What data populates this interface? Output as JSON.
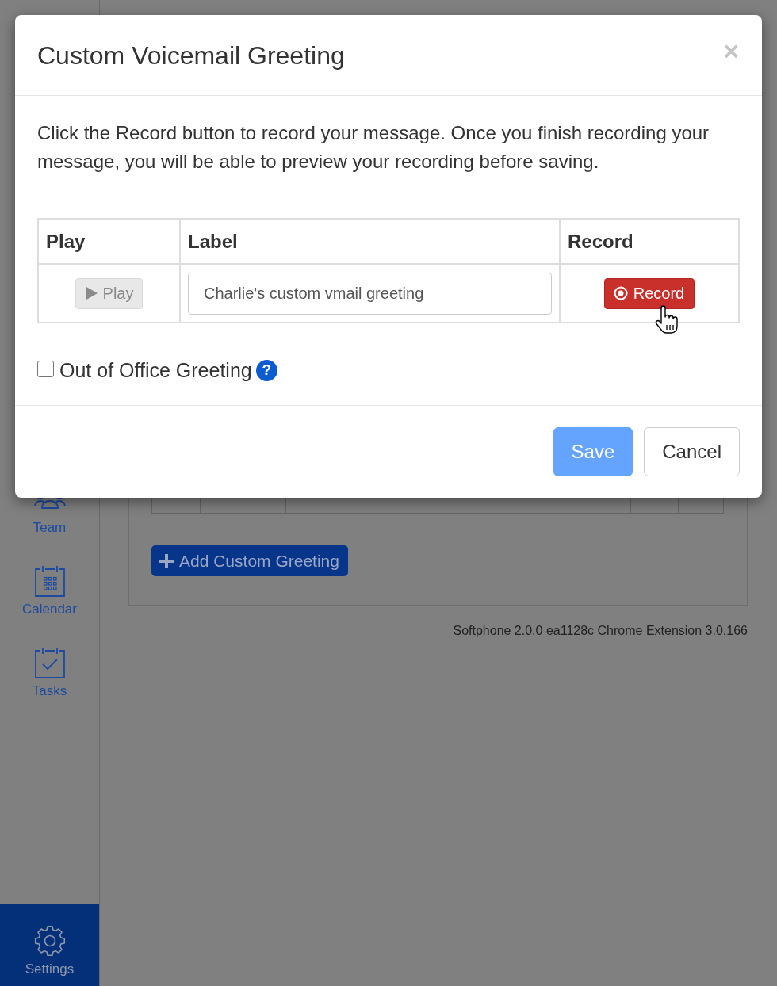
{
  "sidebar": {
    "items": [
      {
        "kind": "team",
        "label": "Team",
        "selected": false
      },
      {
        "kind": "calendar",
        "label": "Calendar",
        "selected": false
      },
      {
        "kind": "tasks",
        "label": "Tasks",
        "selected": false
      },
      {
        "kind": "settings",
        "label": "Settings",
        "selected": true
      }
    ]
  },
  "main": {
    "add_button": {
      "label": "Add Custom Greeting"
    },
    "version": "Softphone 2.0.0 ea1128c Chrome Extension 3.0.166"
  },
  "dialog": {
    "title": "Custom Voicemail Greeting",
    "close": "×",
    "message": "Click the Record button to record your message. Once you finish recording your message, you will be able to preview your recording before saving.",
    "table": {
      "columns": [
        "Play",
        "Label",
        "Record"
      ],
      "rows": [
        {
          "play_button": {
            "label": "Play",
            "disabled": true
          },
          "label_field": {
            "value": "Charlie's custom vmail greeting"
          },
          "record_button": {
            "label": "Record",
            "disabled": false
          }
        }
      ]
    },
    "out_of_office": {
      "label": "Out of Office Greeting",
      "checked": false,
      "help": "?"
    },
    "buttons": [
      {
        "label": "Save",
        "kind": "primary",
        "disabled": true
      },
      {
        "label": "Cancel",
        "kind": "default",
        "disabled": false
      }
    ]
  }
}
